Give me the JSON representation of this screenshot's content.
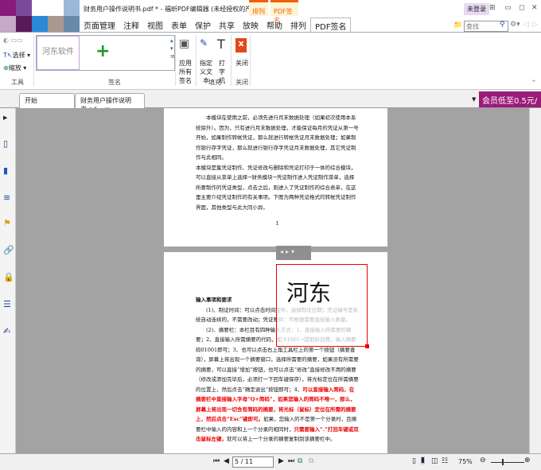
{
  "app": {
    "title": "财务用户操作说明书.pdf * - 福昕PDF编辑器 (未经授权的产品)",
    "login": "未登录"
  },
  "context_tabs": {
    "group1": "排列",
    "group2": "PDF签名"
  },
  "menus": [
    "页面管理",
    "注释",
    "视图",
    "表单",
    "保护",
    "共享",
    "放映",
    "帮助",
    "排列",
    "PDF签名"
  ],
  "search": {
    "placeholder": "查找"
  },
  "ribbon": {
    "tools": {
      "select": "选择",
      "zoom": "缩放",
      "label": "工具"
    },
    "signature": {
      "thumb_text": "河东软件",
      "label": "签名"
    },
    "apply_all": "应用所有签名",
    "fill": {
      "typewriter_text": "指定义文本",
      "typewriter": "打字机",
      "label": "填充"
    },
    "close": {
      "button": "关闭",
      "label": "关闭"
    }
  },
  "doc_tabs": [
    {
      "label": "开始"
    },
    {
      "label": "财务用户操作说明书.pd...",
      "close": "x"
    }
  ],
  "promo": "会员低至0.5元/天",
  "page1": {
    "paragraphs": [
      "本模块在使用之前，必须先进行月末数据处理（如果初次使用本系统除外）。因为，只有进行月末数据处理，才能保证每月的凭证从第一号开始，如果制作转帐凭证，那么就进行转帐凭证月末数据处理；如果制作银行存字凭证，那么就进行银行存字凭证月末数据处理，其它凭证制作与此相同。",
      "本模块是集凭证制作、凭证修改与删除和凭证打印于一体的综合模块，可以直接从菜单上选择→财务模块→凭证制作进入凭证制作菜单，选择所要制作的凭证类型，点击之后，则进入了凭证制作的综合表单，在这里主要介绍凭证制作的有关事项。下图为两种凭证格式的转帐凭证制作界面，其他类型与此大同小异。"
    ],
    "page_mark": "1"
  },
  "signature_stamp": "河东",
  "page2": {
    "heading": "输入事项和要求",
    "p1": "(1)、制证时间：可以点击时间控件，选择制证日期；凭证编号是系统自动连续的，不需要改动；凭证附件：可根据需要直接输入数量。",
    "p2_normal": "(2)、摘要栏：本栏目有四种输入方式：1、直接输入所需要的摘要；2、直接输入所需摘要的代码，如:01001→提取折旧费，输入摘要码01001即可；3、也可以点击右上角工具栏上的第一个按钮（摘要查询），屏幕上将出现一个摘要窗口，选择所需要的摘要，如果没有所需要的摘要，可以直接“增加”按钮，也可以点击“修改”直接修改不用的摘要（修改或添加完毕后，必须打一下回车键保存），将光标定位在所需摘要的位置上，然后点击“确定退出”按钮即可；4、",
    "p2_red": "可以直接输入简码，在摘要栏中直接输入字母“Q+简码”，如果您输入的简码不唯一，那么，屏幕上将出现一切含有简码的摘要，将光标（鼠标）定位在所需的摘要上，然后点击“Esc”键即可。",
    "p2_normal2": "如果，您输入的不是第一个分录时，且摘要栏中输入的内容和上一个分录的相同时，",
    "p2_red2": "只需要输入“.”打回车键或双击鼠标左键，",
    "p2_end": "就可以将上一个分录的摘要复制到该摘要栏中。"
  },
  "status": {
    "page": "5 / 11",
    "zoom": "75%"
  },
  "colors": {
    "accent": "#f06000",
    "promo": "#9b1b7a",
    "canvas": "#a3a3a3",
    "selection": "#e00000"
  }
}
